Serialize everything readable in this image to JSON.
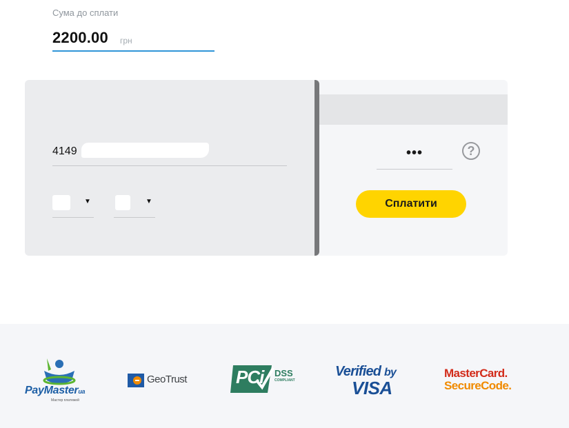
{
  "amount": {
    "label": "Сума до сплати",
    "value": "2200.00",
    "currency": "грн"
  },
  "card_front": {
    "card_number_prefix": "4149",
    "month_select": {
      "value": "",
      "icon": "chevron-down-icon"
    },
    "year_select": {
      "value": "",
      "icon": "chevron-down-icon"
    }
  },
  "card_back": {
    "cvv_value": "•••",
    "help_icon": "question-circle-icon",
    "help_symbol": "?",
    "pay_button_label": "Сплатити"
  },
  "footer": {
    "logos": [
      {
        "name": "PayMaster",
        "brand": "PayMaster",
        "suffix": "ua",
        "tagline": "Мастер платежей"
      },
      {
        "name": "GeoTrust",
        "brand": "GeoTrust"
      },
      {
        "name": "PCI DSS",
        "brand": "PCi",
        "dss": "DSS",
        "compliant": "COMPLIANT"
      },
      {
        "name": "Verified by VISA",
        "verified": "Verified",
        "by": "by",
        "visa": "VISA"
      },
      {
        "name": "MasterCard SecureCode",
        "line1": "MasterCard.",
        "line2": "SecureCode."
      }
    ]
  },
  "colors": {
    "accent_blue": "#2f95d8",
    "pay_button": "#ffd400",
    "card_front_bg": "#ebecee",
    "card_back_bg": "#f5f6f8",
    "footer_bg": "#f5f6f9"
  }
}
